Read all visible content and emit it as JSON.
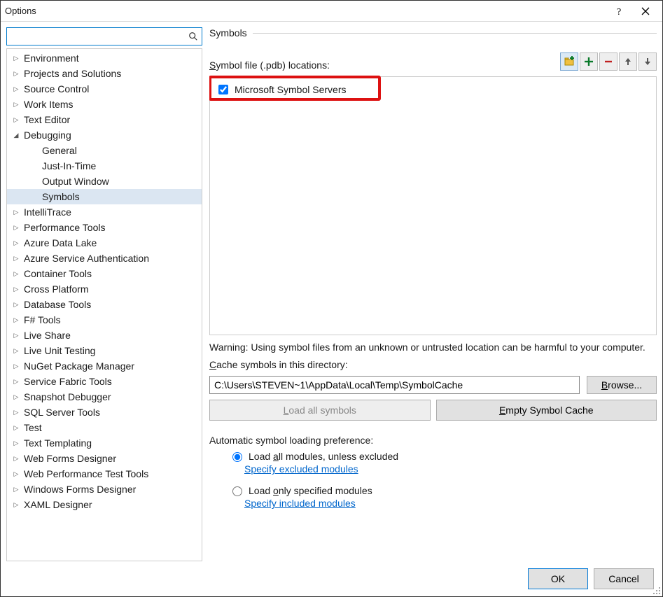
{
  "window": {
    "title": "Options"
  },
  "search": {
    "placeholder": ""
  },
  "tree": {
    "items": [
      {
        "label": "Environment",
        "kind": "top"
      },
      {
        "label": "Projects and Solutions",
        "kind": "top"
      },
      {
        "label": "Source Control",
        "kind": "top"
      },
      {
        "label": "Work Items",
        "kind": "top"
      },
      {
        "label": "Text Editor",
        "kind": "top"
      },
      {
        "label": "Debugging",
        "kind": "top-open"
      },
      {
        "label": "General",
        "kind": "child"
      },
      {
        "label": "Just-In-Time",
        "kind": "child"
      },
      {
        "label": "Output Window",
        "kind": "child"
      },
      {
        "label": "Symbols",
        "kind": "child-selected"
      },
      {
        "label": "IntelliTrace",
        "kind": "top"
      },
      {
        "label": "Performance Tools",
        "kind": "top"
      },
      {
        "label": "Azure Data Lake",
        "kind": "top"
      },
      {
        "label": "Azure Service Authentication",
        "kind": "top"
      },
      {
        "label": "Container Tools",
        "kind": "top"
      },
      {
        "label": "Cross Platform",
        "kind": "top"
      },
      {
        "label": "Database Tools",
        "kind": "top"
      },
      {
        "label": "F# Tools",
        "kind": "top"
      },
      {
        "label": "Live Share",
        "kind": "top"
      },
      {
        "label": "Live Unit Testing",
        "kind": "top"
      },
      {
        "label": "NuGet Package Manager",
        "kind": "top"
      },
      {
        "label": "Service Fabric Tools",
        "kind": "top"
      },
      {
        "label": "Snapshot Debugger",
        "kind": "top"
      },
      {
        "label": "SQL Server Tools",
        "kind": "top"
      },
      {
        "label": "Test",
        "kind": "top"
      },
      {
        "label": "Text Templating",
        "kind": "top"
      },
      {
        "label": "Web Forms Designer",
        "kind": "top"
      },
      {
        "label": "Web Performance Test Tools",
        "kind": "top"
      },
      {
        "label": "Windows Forms Designer",
        "kind": "top"
      },
      {
        "label": "XAML Designer",
        "kind": "top"
      }
    ]
  },
  "main": {
    "heading": "Symbols",
    "locations_prefix": "S",
    "locations_rest": "ymbol file (.pdb) locations:",
    "symbol_items": [
      {
        "label": "Microsoft Symbol Servers",
        "checked": true
      }
    ],
    "warning": "Warning: Using symbol files from an unknown or untrusted location can be harmful to your computer.",
    "cache_prefix": "C",
    "cache_rest": "ache symbols in this directory:",
    "cache_value": "C:\\Users\\STEVEN~1\\AppData\\Local\\Temp\\SymbolCache",
    "browse_prefix": "B",
    "browse_rest": "rowse...",
    "load_all_prefix": "L",
    "load_all_rest": "oad all symbols",
    "empty_cache_prefix": "E",
    "empty_cache_rest": "mpty Symbol Cache",
    "pref_heading": "Automatic symbol loading preference:",
    "radio1_prefix": "Load ",
    "radio1_u": "a",
    "radio1_rest": "ll modules, unless excluded",
    "link1": "Specify excluded modules",
    "radio2_prefix": "Load ",
    "radio2_u": "o",
    "radio2_rest": "nly specified modules",
    "link2": "Specify included modules"
  },
  "footer": {
    "ok": "OK",
    "cancel": "Cancel"
  }
}
